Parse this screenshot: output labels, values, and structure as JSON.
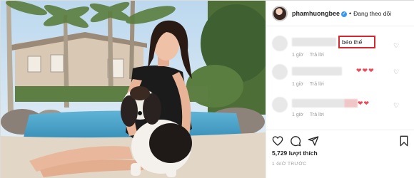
{
  "header": {
    "username": "phamhuongbee",
    "verified_mark": "✓",
    "separator": "•",
    "follow_status": "Đang theo dõi",
    "avatar_icon": "profile-avatar"
  },
  "comments": [
    {
      "text": "béo thế",
      "time": "1 giờ",
      "reply": "Trả lời",
      "highlighted": true,
      "heart_icon": "heart-outline-icon"
    },
    {
      "text": "",
      "time": "1 giờ",
      "reply": "Trả lời",
      "emoji": "❤❤❤"
    },
    {
      "text": "",
      "time": "1 giờ",
      "reply": "Trả lời",
      "emoji": "❤❤"
    }
  ],
  "post": {
    "likes": "5,729 lượt thích",
    "date": "1 GIỜ TRƯỚC",
    "icons": [
      "heart-outline-icon",
      "comment-bubble-icon",
      "share-arrow-icon",
      "bookmark-icon"
    ]
  },
  "colors": {
    "highlight_border": "#d6262f",
    "heart_red": "#ed4956",
    "verified_blue": "#3897f0"
  }
}
